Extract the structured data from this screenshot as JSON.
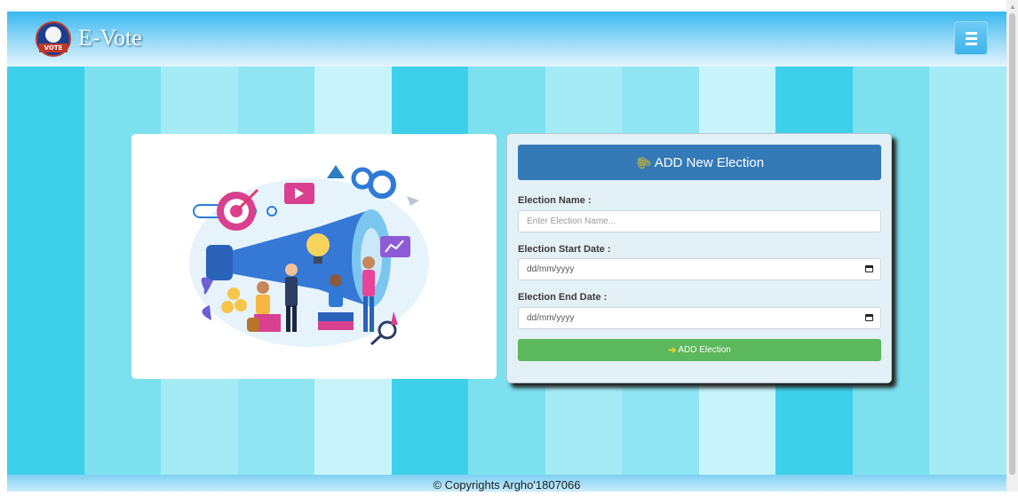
{
  "header": {
    "brand": "E-Vote",
    "logo_text": "VOTE"
  },
  "form": {
    "title": "ADD New Election",
    "name_label": "Election Name :",
    "name_placeholder": "Enter Election Name...",
    "start_label": "Election Start Date :",
    "start_value": "dd/mm/yyyy",
    "end_label": "Election End Date :",
    "end_value": "dd/mm/yyyy",
    "submit_label": "ADD Election"
  },
  "footer": {
    "text": "© Copyrights Argho'1807066"
  },
  "colors": {
    "stripes": [
      "#3fd0e9",
      "#7ce0ef",
      "#a4ebf5",
      "#8fe6f2",
      "#c8f3fa",
      "#3fd0e9",
      "#7ce0ef",
      "#a4ebf5",
      "#8fe6f2",
      "#c8f3fa",
      "#3fd0e9",
      "#7ce0ef",
      "#a4ebf5"
    ],
    "header_button": "#337ab7",
    "submit_button": "#5cb85c"
  },
  "icons": {
    "header_icon": "paperclip-icon",
    "submit_icon": "sign-in-icon",
    "menu_icon": "hamburger-icon"
  }
}
